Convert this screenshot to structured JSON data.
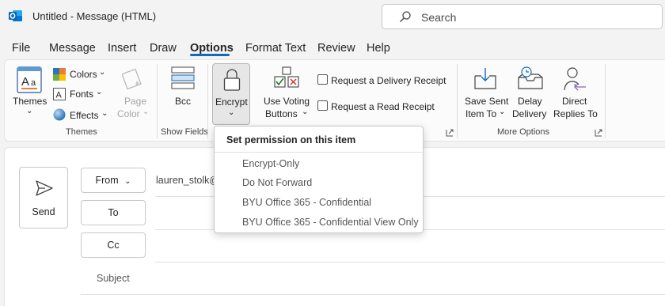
{
  "titlebar": {
    "title": "Untitled  -  Message (HTML)",
    "search_placeholder": "Search"
  },
  "menu": {
    "tabs": [
      "File",
      "Message",
      "Insert",
      "Draw",
      "Options",
      "Format Text",
      "Review",
      "Help"
    ],
    "active": "Options"
  },
  "ribbon": {
    "themes_group": {
      "themes_label": "Themes",
      "colors_label": "Colors",
      "fonts_label": "Fonts",
      "effects_label": "Effects",
      "page_color_line1": "Page",
      "page_color_line2": "Color",
      "group_label": "Themes"
    },
    "show_fields_group": {
      "bcc_label": "Bcc",
      "group_label": "Show Fields"
    },
    "encrypt_label": "Encrypt",
    "tracking_group": {
      "voting_line1": "Use Voting",
      "voting_line2": "Buttons",
      "delivery_receipt": "Request a Delivery Receipt",
      "read_receipt": "Request a Read Receipt"
    },
    "more_options_group": {
      "save_sent_line1": "Save Sent",
      "save_sent_line2": "Item To",
      "delay_line1": "Delay",
      "delay_line2": "Delivery",
      "direct_line1": "Direct",
      "direct_line2": "Replies To",
      "group_label": "More Options"
    }
  },
  "dropdown": {
    "title": "Set permission on this item",
    "items": [
      "Encrypt-Only",
      "Do Not Forward",
      "BYU Office 365 - Confidential",
      "BYU Office 365 - Confidential View Only"
    ]
  },
  "compose": {
    "send_label": "Send",
    "from_label": "From",
    "from_value": "lauren_stolk@",
    "to_label": "To",
    "cc_label": "Cc",
    "subject_label": "Subject"
  },
  "colors": {
    "accent": "#0f6cbd",
    "outlook_blue": "#0364b8"
  }
}
